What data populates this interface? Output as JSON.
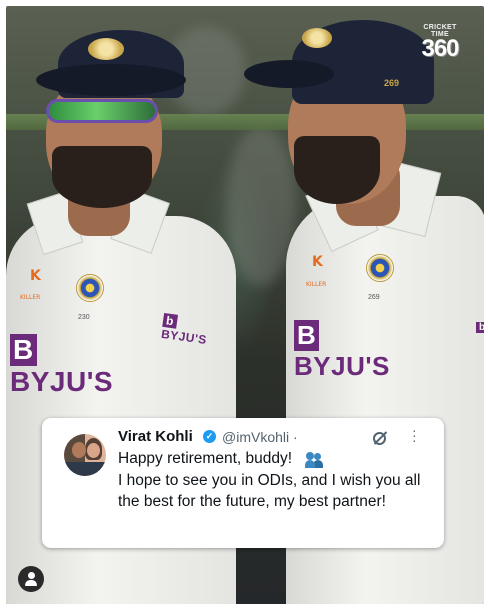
{
  "brand": {
    "line1": "CRICKET TIME",
    "line2": "360"
  },
  "photo": {
    "left_player": {
      "cap_number": "",
      "shirt_number": "230",
      "sponsor": "BYJU'S",
      "sleeve_sponsor": "BYJU'S",
      "kit_logo": "K",
      "kit_brand": "KILLER"
    },
    "right_player": {
      "cap_number": "269",
      "shirt_number": "269",
      "sponsor": "BYJU'S",
      "kit_logo": "K",
      "kit_brand": "KILLER"
    }
  },
  "tweet": {
    "author_name": "Virat Kohli",
    "handle": "@imVkohli ·",
    "line1": "Happy retirement, buddy!",
    "body": "I hope to see you in ODIs, and I wish you all the best for the future, my best partner!",
    "icons": {
      "verified": "verified-badge-icon",
      "grok": "grok-icon",
      "more": "more-options-icon",
      "emoji": "two-people-emoji-icon"
    }
  },
  "colors": {
    "verified_blue": "#1d9bf0",
    "sponsor_purple": "#6b2a7a",
    "cap_navy": "#1d2438"
  },
  "overlay": {
    "profile_icon": "profile-icon"
  }
}
